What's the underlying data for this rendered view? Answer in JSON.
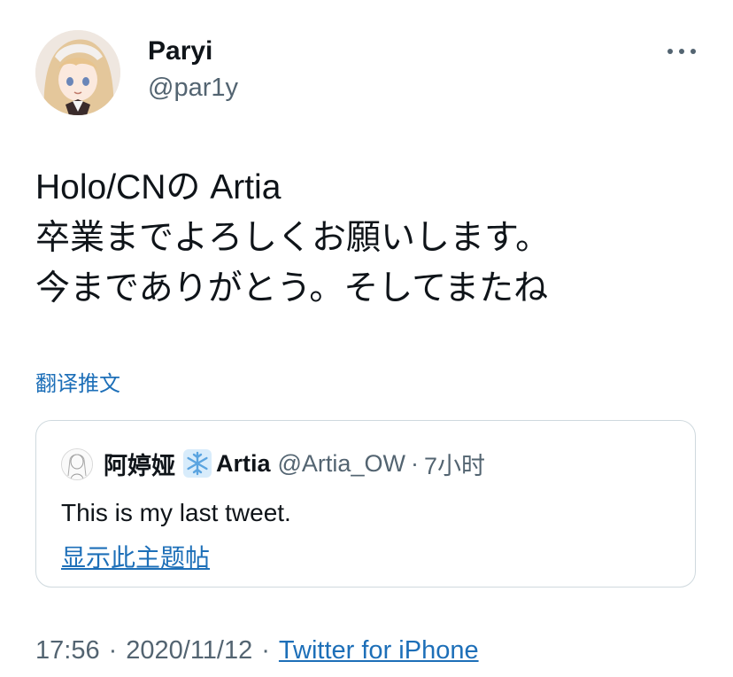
{
  "author": {
    "name": "Paryi",
    "handle": "@par1y",
    "avatar_icon": "anime-girl-avatar"
  },
  "more_icon": "more-horizontal-icon",
  "tweet": {
    "lines": [
      "Holo/CNの Artia",
      "卒業までよろしくお願いします。",
      "今までありがとう。そしてまたね"
    ]
  },
  "translate_label": "翻译推文",
  "quoted": {
    "avatar_icon": "sketch-avatar",
    "name": "阿婷娅",
    "emoji_icon": "snowflake-icon",
    "name_suffix": "Artia",
    "handle": "@Artia_OW",
    "separator": "·",
    "time": "7小时",
    "text": "This is my last tweet.",
    "thread_link": "显示此主题帖"
  },
  "meta": {
    "time": "17:56",
    "separator": "·",
    "date": "2020/11/12",
    "source": "Twitter for iPhone"
  },
  "colors": {
    "link": "#1d6fb8",
    "secondary_text": "#536471",
    "border": "#cfd9de"
  }
}
